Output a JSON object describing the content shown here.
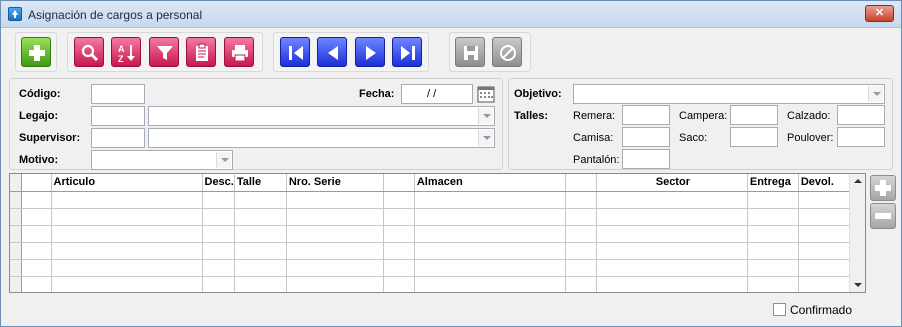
{
  "window": {
    "title": "Asignación de cargos a personal",
    "close_symbol": "✕"
  },
  "toolbar": {
    "add": "add-icon",
    "search": "magnifier-icon",
    "sort": "sort-az-icon",
    "filter": "filter-icon",
    "report": "report-icon",
    "print": "printer-icon",
    "first": "first-record-icon",
    "prev": "prev-record-icon",
    "next": "next-record-icon",
    "last": "last-record-icon",
    "save": "save-icon",
    "cancel": "cancel-icon"
  },
  "form": {
    "codigo_label": "Código:",
    "fecha_label": "Fecha:",
    "fecha_value": "/ /",
    "legajo_label": "Legajo:",
    "supervisor_label": "Supervisor:",
    "motivo_label": "Motivo:",
    "objetivo_label": "Objetivo:",
    "talles_label": "Talles:",
    "remera_label": "Remera:",
    "campera_label": "Campera:",
    "calzado_label": "Calzado:",
    "camisa_label": "Camisa:",
    "saco_label": "Saco:",
    "poulover_label": "Poulover:",
    "pantalon_label": "Pantalón:"
  },
  "grid": {
    "columns": [
      "Articulo",
      "Desc.",
      "Talle",
      "Nro. Serie",
      "",
      "Almacen",
      "",
      "Sector",
      "Entrega",
      "Devol."
    ],
    "rows": 6
  },
  "footer": {
    "confirmado_label": "Confirmado"
  },
  "colors": {
    "green": "#3e9a15",
    "pink": "#c8174f",
    "blue": "#1c2fd8",
    "gray": "#8e8e8e"
  }
}
